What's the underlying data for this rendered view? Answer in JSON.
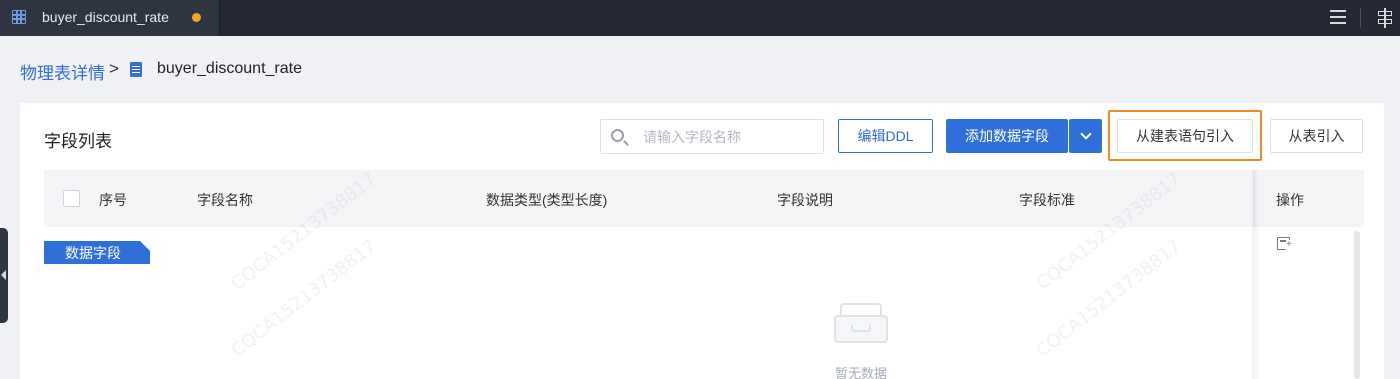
{
  "tab": {
    "title": "buyer_discount_rate",
    "unsaved_dot_color": "#f5a623"
  },
  "topbar_icons": [
    "menu-icon",
    "layout-icon"
  ],
  "breadcrumb": {
    "parent": "物理表详情",
    "separator": ">",
    "current": "buyer_discount_rate"
  },
  "panel": {
    "title": "字段列表",
    "search": {
      "placeholder": "请输入字段名称",
      "value": ""
    },
    "buttons": {
      "edit_ddl": "编辑DDL",
      "add_field": "添加数据字段",
      "import_from_ddl": "从建表语句引入",
      "import_from_table": "从表引入"
    }
  },
  "table": {
    "columns": [
      "序号",
      "字段名称",
      "数据类型(类型长度)",
      "字段说明",
      "字段标准",
      "操作"
    ],
    "section_label": "数据字段",
    "empty_text": "暂无数据"
  },
  "watermark": "CQCA15213738817",
  "colors": {
    "accent": "#2e6fd8",
    "highlight": "#f08a24",
    "topbar": "#232833"
  }
}
